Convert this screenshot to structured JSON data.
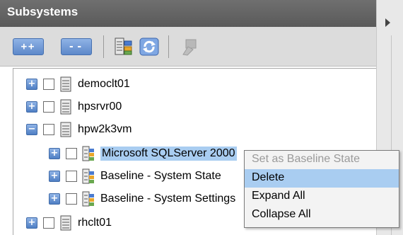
{
  "header": {
    "title": "Subsystems"
  },
  "toolbar": {
    "expand_all_label": "++",
    "collapse_all_label": "--",
    "icons": [
      "subsystem-properties-icon",
      "refresh-icon",
      "disabled-action-icon"
    ]
  },
  "tree": {
    "nodes": [
      {
        "label": "democlt01",
        "expander": "+",
        "icon": "server-icon"
      },
      {
        "label": "hpsrvr00",
        "expander": "+",
        "icon": "server-icon"
      },
      {
        "label": "hpw2k3vm",
        "expander": "−",
        "icon": "server-icon"
      },
      {
        "label": "Microsoft SQLServer 2000",
        "expander": "+",
        "icon": "subsystem-icon",
        "selected": true
      },
      {
        "label": "Baseline - System State",
        "expander": "+",
        "icon": "subsystem-icon"
      },
      {
        "label": "Baseline - System Settings",
        "expander": "+",
        "icon": "subsystem-icon"
      },
      {
        "label": "rhclt01",
        "expander": "+",
        "icon": "server-icon"
      }
    ]
  },
  "context_menu": {
    "items": [
      {
        "label": "Set as Baseline State",
        "disabled": true
      },
      {
        "label": "Delete",
        "highlighted": true
      },
      {
        "label": "Expand All"
      },
      {
        "label": "Collapse All"
      }
    ]
  },
  "colors": {
    "header_bg": "#6a6a6a",
    "toolbar_bg": "#dcdcdc",
    "selection": "#a9cdf1",
    "expander": "#5d88c9"
  }
}
